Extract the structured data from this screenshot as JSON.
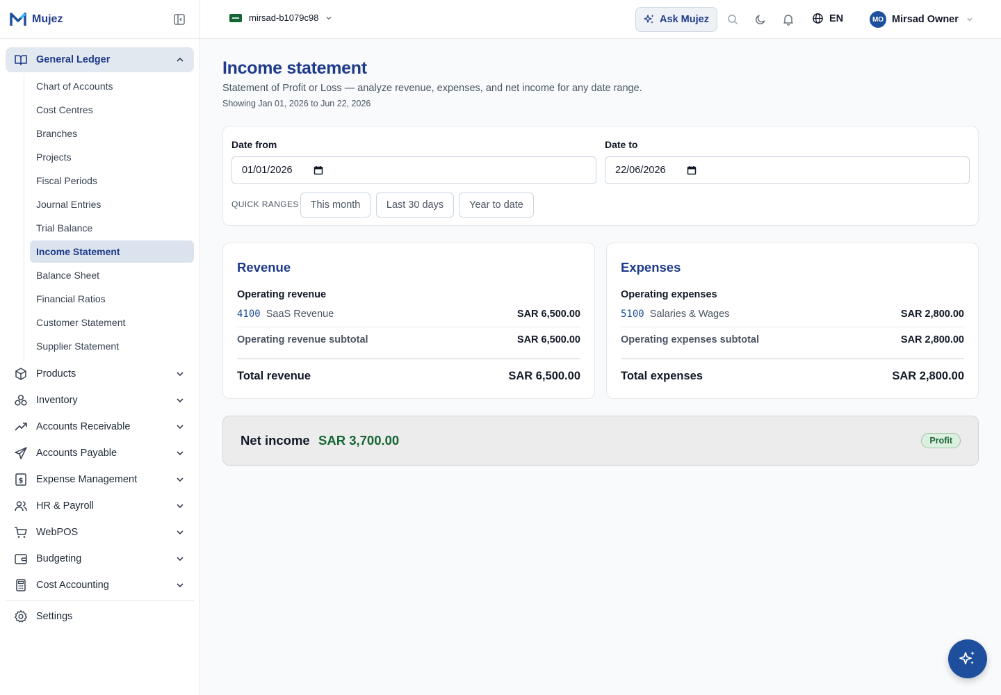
{
  "brand": {
    "name": "Mujez"
  },
  "sidebar": {
    "active_group": {
      "label": "General Ledger",
      "items": [
        {
          "label": "Chart of Accounts"
        },
        {
          "label": "Cost Centres"
        },
        {
          "label": "Branches"
        },
        {
          "label": "Projects"
        },
        {
          "label": "Fiscal Periods"
        },
        {
          "label": "Journal Entries"
        },
        {
          "label": "Trial Balance"
        },
        {
          "label": "Income Statement",
          "active": true
        },
        {
          "label": "Balance Sheet"
        },
        {
          "label": "Financial Ratios"
        },
        {
          "label": "Customer Statement"
        },
        {
          "label": "Supplier Statement"
        }
      ]
    },
    "groups": [
      {
        "label": "Products",
        "icon": "box-icon"
      },
      {
        "label": "Inventory",
        "icon": "boxes-icon"
      },
      {
        "label": "Accounts Receivable",
        "icon": "trending-up-icon"
      },
      {
        "label": "Accounts Payable",
        "icon": "send-icon"
      },
      {
        "label": "Expense Management",
        "icon": "receipt-icon"
      },
      {
        "label": "HR & Payroll",
        "icon": "users-icon"
      },
      {
        "label": "WebPOS",
        "icon": "cart-icon"
      },
      {
        "label": "Budgeting",
        "icon": "wallet-icon"
      },
      {
        "label": "Cost Accounting",
        "icon": "calculator-icon"
      }
    ],
    "settings_label": "Settings"
  },
  "topbar": {
    "org_name": "mirsad-b1079c98",
    "ask_label": "Ask Mujez",
    "lang": "EN",
    "user_initials": "MO",
    "user_name": "Mirsad Owner"
  },
  "page": {
    "title": "Income statement",
    "description": "Statement of Profit or Loss — analyze revenue, expenses, and net income for any date range.",
    "showing": "Showing Jan 01, 2026 to Jun 22, 2026"
  },
  "filters": {
    "date_from_label": "Date from",
    "date_from_value": "01/01/2026",
    "date_to_label": "Date to",
    "date_to_value": "22/06/2026",
    "quick_ranges_label": "QUICK RANGES",
    "quick_ranges": [
      "This month",
      "Last 30 days",
      "Year to date"
    ]
  },
  "revenue": {
    "title": "Revenue",
    "section": "Operating revenue",
    "line": {
      "code": "4100",
      "name": "SaaS Revenue",
      "amount": "SAR 6,500.00"
    },
    "subtotal_label": "Operating revenue subtotal",
    "subtotal_amount": "SAR 6,500.00",
    "total_label": "Total revenue",
    "total_amount": "SAR 6,500.00"
  },
  "expenses": {
    "title": "Expenses",
    "section": "Operating expenses",
    "line": {
      "code": "5100",
      "name": "Salaries & Wages",
      "amount": "SAR 2,800.00"
    },
    "subtotal_label": "Operating expenses subtotal",
    "subtotal_amount": "SAR 2,800.00",
    "total_label": "Total expenses",
    "total_amount": "SAR 2,800.00"
  },
  "net_income": {
    "label": "Net income",
    "value": "SAR 3,700.00",
    "badge": "Profit"
  },
  "colors": {
    "primary": "#1e3a8a",
    "accent": "#1e4f9c",
    "profit": "#166534"
  }
}
